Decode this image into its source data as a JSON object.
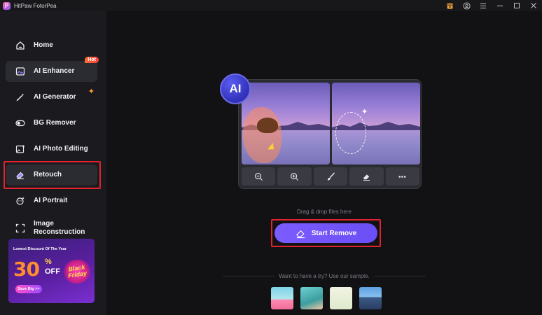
{
  "window": {
    "title": "HitPaw FotorPea"
  },
  "sidebar": {
    "items": [
      {
        "label": "Home"
      },
      {
        "label": "AI Enhancer",
        "badge": "Hot"
      },
      {
        "label": "AI Generator"
      },
      {
        "label": "BG Remover"
      },
      {
        "label": "AI Photo Editing"
      },
      {
        "label": "Retouch"
      },
      {
        "label": "AI Portrait"
      },
      {
        "label": "Image Reconstruction"
      }
    ],
    "promo": {
      "top_text": "Lowest Discount Of The Year",
      "percent": "30",
      "percent_sign": "%",
      "off": "OFF",
      "badge_line1": "Black",
      "badge_line2": "Friday",
      "button": "Save Big >>"
    }
  },
  "main": {
    "ai_badge": "AI",
    "drop_hint": "Drag & drop files here",
    "start_button": "Start Remove",
    "sample_hint": "Want to have a try? Use our sample."
  },
  "colors": {
    "accent": "#7b5cff",
    "highlight_box": "#e0232c",
    "hot_badge": "#ff4a2c"
  },
  "icons": {
    "toolbar": [
      "zoom-out-icon",
      "zoom-in-icon",
      "brush-icon",
      "eraser-icon",
      "more-icon"
    ],
    "titlebar": [
      "store-icon",
      "account-icon",
      "menu-icon",
      "minimize-icon",
      "maximize-icon",
      "close-icon"
    ]
  }
}
